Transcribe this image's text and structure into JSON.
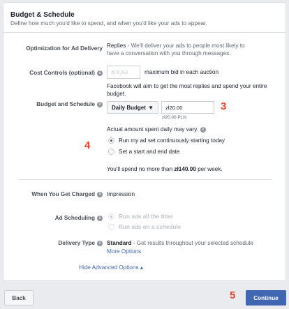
{
  "header": {
    "title": "Budget & Schedule",
    "subtitle": "Define how much you'd like to spend, and when you'd like your ads to appear."
  },
  "optimization": {
    "label": "Optimization for Ad Delivery",
    "value": "Replies",
    "description": " - We'll deliver your ads to people most likely to",
    "description_line2": "have a conversation with you through messages."
  },
  "cost_controls": {
    "label": "Cost Controls (optional)",
    "placeholder": "zł X.XX",
    "suffix": "maximum bid in each auction",
    "note_line1": "Facebook will aim to get the most replies and spend your entire",
    "note_line2": "budget."
  },
  "budget": {
    "label": "Budget and Schedule",
    "type": "Daily Budget",
    "amount": "zł20.00",
    "amount_caption": "zł20.00 PLN",
    "annotation_3": "3",
    "actual_note": "Actual amount spent daily may vary.",
    "annotation_4": "4",
    "schedule_options": [
      {
        "label": "Run my ad set continuously starting today",
        "selected": true
      },
      {
        "label": "Set a start and end date",
        "selected": false
      }
    ],
    "spend_prefix": "You'll spend no more than ",
    "spend_amount": "zł140.00",
    "spend_suffix": " per week."
  },
  "charged": {
    "label": "When You Get Charged",
    "value": "Impression"
  },
  "ad_scheduling": {
    "label": "Ad Scheduling",
    "options": [
      {
        "label": "Run ads all the time",
        "selected": true
      },
      {
        "label": "Run ads on a schedule",
        "selected": false
      }
    ]
  },
  "delivery": {
    "label": "Delivery Type",
    "value": "Standard",
    "description": " - Get results throughout your selected schedule",
    "more_link": "More Options"
  },
  "advanced_toggle": "Hide Advanced Options ▴",
  "footer": {
    "back_label": "Back",
    "continue_label": "Continue",
    "annotation_5": "5"
  },
  "colors": {
    "accent": "#4267b2",
    "annotation": "#e9422c"
  }
}
